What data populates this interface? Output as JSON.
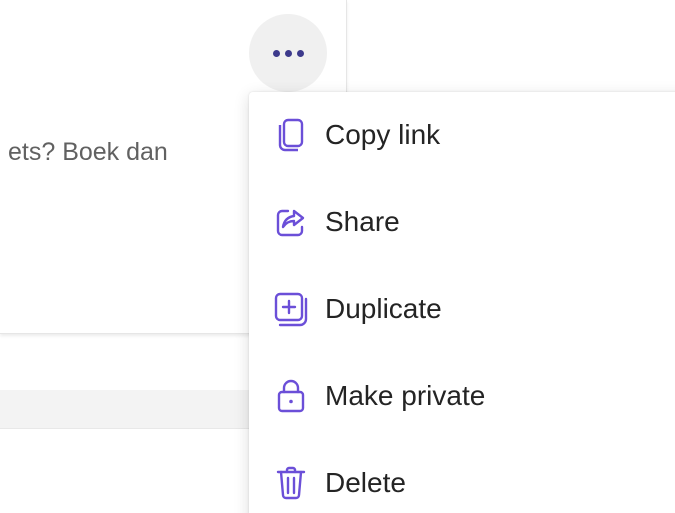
{
  "card": {
    "snippet": "ets? Boek dan"
  },
  "more_button": {
    "icon": "more-horizontal-icon"
  },
  "menu": {
    "accent_color": "#6b4fd8",
    "items": [
      {
        "label": "Copy link",
        "icon": "copy-icon"
      },
      {
        "label": "Share",
        "icon": "share-icon"
      },
      {
        "label": "Duplicate",
        "icon": "duplicate-icon"
      },
      {
        "label": "Make private",
        "icon": "lock-icon"
      },
      {
        "label": "Delete",
        "icon": "trash-icon"
      }
    ]
  }
}
